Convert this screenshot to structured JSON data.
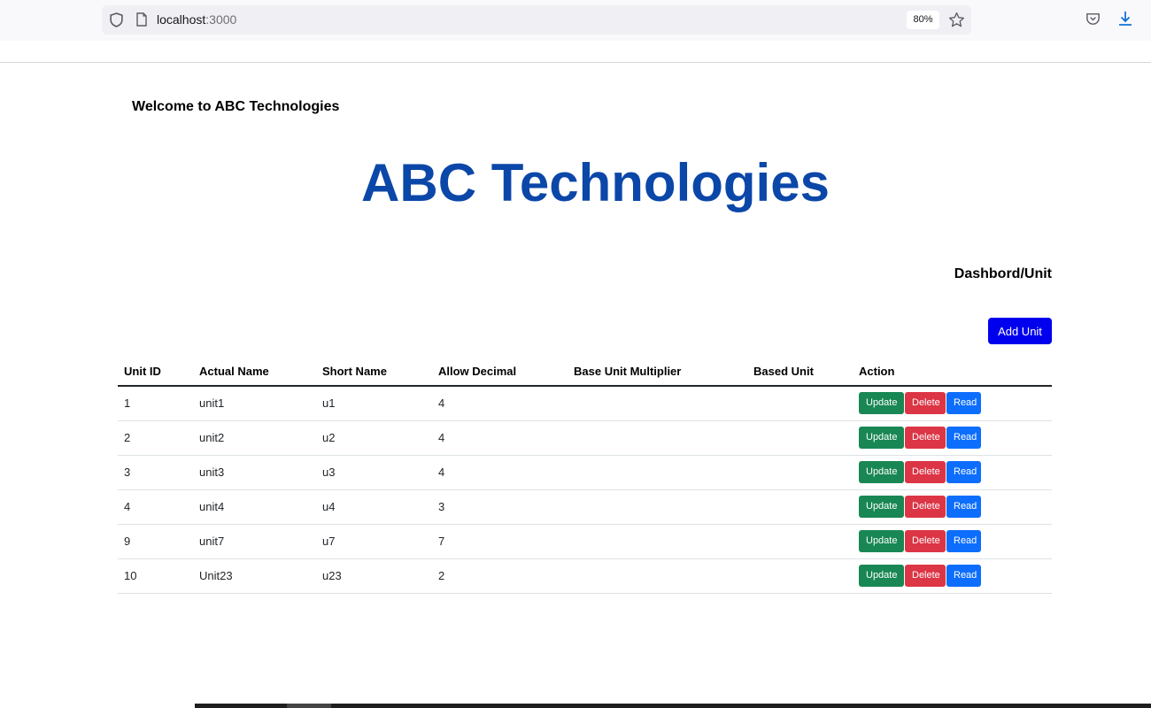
{
  "browser": {
    "url_host": "localhost",
    "url_port": ":3000",
    "zoom": "80%",
    "icons": [
      "shield-icon",
      "page-icon",
      "star-icon",
      "pocket-icon",
      "download-icon"
    ]
  },
  "page": {
    "welcome": "Welcome to ABC Technologies",
    "brand": "ABC Technologies",
    "breadcrumb": "Dashbord/Unit",
    "add_button": "Add Unit"
  },
  "table": {
    "headers": [
      "Unit ID",
      "Actual Name",
      "Short Name",
      "Allow Decimal",
      "Base Unit Multiplier",
      "Based Unit",
      "Action"
    ],
    "rows": [
      {
        "id": "1",
        "actual": "unit1",
        "short": "u1",
        "decimal": "4",
        "multiplier": "",
        "based": ""
      },
      {
        "id": "2",
        "actual": "unit2",
        "short": "u2",
        "decimal": "4",
        "multiplier": "",
        "based": ""
      },
      {
        "id": "3",
        "actual": "unit3",
        "short": "u3",
        "decimal": "4",
        "multiplier": "",
        "based": ""
      },
      {
        "id": "4",
        "actual": "unit4",
        "short": "u4",
        "decimal": "3",
        "multiplier": "",
        "based": ""
      },
      {
        "id": "9",
        "actual": "unit7",
        "short": "u7",
        "decimal": "7",
        "multiplier": "",
        "based": ""
      },
      {
        "id": "10",
        "actual": "Unit23",
        "short": "u23",
        "decimal": "2",
        "multiplier": "",
        "based": ""
      }
    ],
    "actions": {
      "update": "Update",
      "delete": "Delete",
      "read": "Read"
    }
  },
  "colors": {
    "brand": "#0b47a8",
    "add_button": "#0000ee",
    "update": "#198754",
    "delete": "#dc3545",
    "read": "#0d6efd"
  }
}
